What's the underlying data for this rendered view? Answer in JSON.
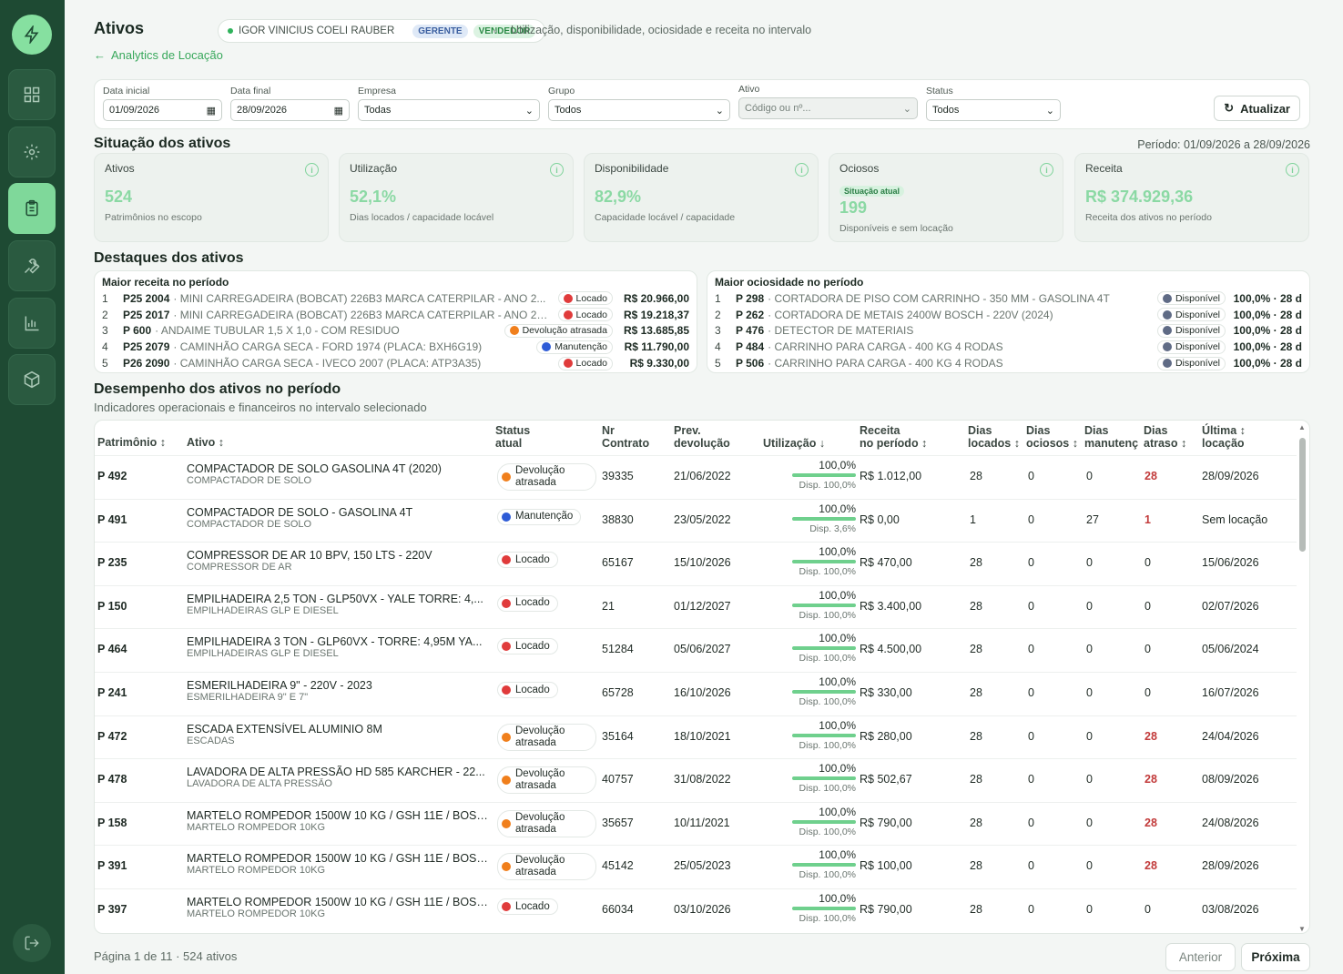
{
  "header": {
    "title": "Ativos",
    "user_name": "IGOR VINICIUS COELI RAUBER",
    "roles": [
      "GERENTE",
      "VENDEDOR"
    ],
    "subtitle": "Utilização, disponibilidade, ociosidade e receita no intervalo",
    "back_link": "Analytics de Locação"
  },
  "filters": {
    "data_inicial": {
      "label": "Data inicial",
      "value": "01/09/2026"
    },
    "data_final": {
      "label": "Data final",
      "value": "28/09/2026"
    },
    "empresa": {
      "label": "Empresa",
      "value": "Todas"
    },
    "grupo": {
      "label": "Grupo",
      "value": "Todos"
    },
    "ativo": {
      "label": "Ativo",
      "placeholder": "Código ou nº..."
    },
    "status": {
      "label": "Status",
      "value": "Todos"
    },
    "refresh_label": "Atualizar"
  },
  "situacao": {
    "title": "Situação dos ativos",
    "periodo": "Período: 01/09/2026 a 28/09/2026",
    "cards": [
      {
        "label": "Ativos",
        "value": "524",
        "desc": "Patrimônios no escopo"
      },
      {
        "label": "Utilização",
        "value": "52,1%",
        "desc": "Dias locados / capacidade locável"
      },
      {
        "label": "Disponibilidade",
        "value": "82,9%",
        "desc": "Capacidade locável / capacidade"
      },
      {
        "label": "Ociosos",
        "tag": "Situação atual",
        "value": "199",
        "desc": "Disponíveis e sem locação"
      },
      {
        "label": "Receita",
        "value": "R$ 374.929,36",
        "desc": "Receita dos ativos no período"
      }
    ]
  },
  "destaques": {
    "title": "Destaques dos ativos",
    "receita": {
      "title": "Maior receita no período",
      "rows": [
        {
          "n": "1",
          "pat": "P25 2004",
          "name": "· MINI CARREGADEIRA (BOBCAT) 226B3 MARCA CATERPILAR - ANO 2...",
          "status": "Locado",
          "value": "R$ 20.966,00"
        },
        {
          "n": "2",
          "pat": "P25 2017",
          "name": "· MINI CARREGADEIRA (BOBCAT) 226B3 MARCA CATERPILAR - ANO 2024",
          "status": "Locado",
          "value": "R$ 19.218,37"
        },
        {
          "n": "3",
          "pat": "P 600",
          "name": "· ANDAIME TUBULAR 1,5 X 1,0 - COM RESIDUO",
          "status": "Devolução atrasada",
          "value": "R$ 13.685,85"
        },
        {
          "n": "4",
          "pat": "P25 2079",
          "name": "· CAMINHÃO CARGA SECA - FORD 1974 (PLACA: BXH6G19)",
          "status": "Manutenção",
          "value": "R$ 11.790,00"
        },
        {
          "n": "5",
          "pat": "P26 2090",
          "name": "· CAMINHÃO CARGA SECA - IVECO 2007 (PLACA: ATP3A35)",
          "status": "Locado",
          "value": "R$ 9.330,00"
        }
      ]
    },
    "ociosidade": {
      "title": "Maior ociosidade no período",
      "rows": [
        {
          "n": "1",
          "pat": "P 298",
          "name": "· CORTADORA DE PISO COM CARRINHO - 350 MM - GASOLINA 4T",
          "status": "Disponível",
          "value": "100,0% · 28 d"
        },
        {
          "n": "2",
          "pat": "P 262",
          "name": "· CORTADORA DE METAIS 2400W BOSCH - 220V (2024)",
          "status": "Disponível",
          "value": "100,0% · 28 d"
        },
        {
          "n": "3",
          "pat": "P 476",
          "name": "· DETECTOR DE MATERIAIS",
          "status": "Disponível",
          "value": "100,0% · 28 d"
        },
        {
          "n": "4",
          "pat": "P 484",
          "name": "· CARRINHO PARA CARGA - 400 KG 4 RODAS",
          "status": "Disponível",
          "value": "100,0% · 28 d"
        },
        {
          "n": "5",
          "pat": "P 506",
          "name": "· CARRINHO PARA CARGA - 400 KG 4 RODAS",
          "status": "Disponível",
          "value": "100,0% · 28 d"
        }
      ]
    }
  },
  "desempenho": {
    "title": "Desempenho dos ativos no período",
    "subtitle": "Indicadores operacionais e financeiros no intervalo selecionado",
    "columns": {
      "patrimonio": "Patrimônio ↕",
      "ativo": "Ativo ↕",
      "status1": "Status",
      "status2": "atual",
      "contrato1": "Nr",
      "contrato2": "Contrato",
      "prev1": "Prev.",
      "prev2": "devolução",
      "util": "Utilização ↓",
      "receita1": "Receita",
      "receita2": "no período ↕",
      "locados1": "Dias",
      "locados2": "locados ↕",
      "ociosos1": "Dias",
      "ociosos2": "ociosos ↕",
      "manut1": "Dias",
      "manut2": "manutenç",
      "atraso1": "Dias",
      "atraso2": "atraso ↕",
      "ultima1": "Última ↕",
      "ultima2": "locação"
    },
    "rows": [
      {
        "pat": "P 492",
        "ativo": "COMPACTADOR DE SOLO GASOLINA 4T (2020)",
        "grupo": "COMPACTADOR DE SOLO",
        "status": "Devolução atrasada",
        "contrato": "39335",
        "prev": "21/06/2022",
        "util": "100,0%",
        "util_pct": 100,
        "disp": "Disp. 100,0%",
        "receita": "R$ 1.012,00",
        "locados": "28",
        "ociosos": "0",
        "manut": "0",
        "atraso": "28",
        "ultima": "28/09/2026"
      },
      {
        "pat": "P 491",
        "ativo": "COMPACTADOR DE SOLO - GASOLINA 4T",
        "grupo": "COMPACTADOR DE SOLO",
        "status": "Manutenção",
        "contrato": "38830",
        "prev": "23/05/2022",
        "util": "100,0%",
        "util_pct": 100,
        "disp": "Disp. 3,6%",
        "receita": "R$ 0,00",
        "locados": "1",
        "ociosos": "0",
        "manut": "27",
        "atraso": "1",
        "ultima": "Sem locação"
      },
      {
        "pat": "P 235",
        "ativo": "COMPRESSOR DE AR 10 BPV, 150 LTS - 220V",
        "grupo": "COMPRESSOR DE AR",
        "status": "Locado",
        "contrato": "65167",
        "prev": "15/10/2026",
        "util": "100,0%",
        "util_pct": 100,
        "disp": "Disp. 100,0%",
        "receita": "R$ 470,00",
        "locados": "28",
        "ociosos": "0",
        "manut": "0",
        "atraso": "0",
        "ultima": "15/06/2026"
      },
      {
        "pat": "P 150",
        "ativo": "EMPILHADEIRA 2,5 TON - GLP50VX - YALE TORRE: 4,...",
        "grupo": "EMPILHADEIRAS GLP E DIESEL",
        "status": "Locado",
        "contrato": "21",
        "prev": "01/12/2027",
        "util": "100,0%",
        "util_pct": 100,
        "disp": "Disp. 100,0%",
        "receita": "R$ 3.400,00",
        "locados": "28",
        "ociosos": "0",
        "manut": "0",
        "atraso": "0",
        "ultima": "02/07/2026"
      },
      {
        "pat": "P 464",
        "ativo": "EMPILHADEIRA 3 TON - GLP60VX - TORRE: 4,95M YA...",
        "grupo": "EMPILHADEIRAS GLP E DIESEL",
        "status": "Locado",
        "contrato": "51284",
        "prev": "05/06/2027",
        "util": "100,0%",
        "util_pct": 100,
        "disp": "Disp. 100,0%",
        "receita": "R$ 4.500,00",
        "locados": "28",
        "ociosos": "0",
        "manut": "0",
        "atraso": "0",
        "ultima": "05/06/2024"
      },
      {
        "pat": "P 241",
        "ativo": "ESMERILHADEIRA 9\" - 220V - 2023",
        "grupo": "ESMERILHADEIRA 9\" E 7\"",
        "status": "Locado",
        "contrato": "65728",
        "prev": "16/10/2026",
        "util": "100,0%",
        "util_pct": 100,
        "disp": "Disp. 100,0%",
        "receita": "R$ 330,00",
        "locados": "28",
        "ociosos": "0",
        "manut": "0",
        "atraso": "0",
        "ultima": "16/07/2026"
      },
      {
        "pat": "P 472",
        "ativo": "ESCADA EXTENSÍVEL ALUMINIO 8M",
        "grupo": "ESCADAS",
        "status": "Devolução atrasada",
        "contrato": "35164",
        "prev": "18/10/2021",
        "util": "100,0%",
        "util_pct": 100,
        "disp": "Disp. 100,0%",
        "receita": "R$ 280,00",
        "locados": "28",
        "ociosos": "0",
        "manut": "0",
        "atraso": "28",
        "ultima": "24/04/2026"
      },
      {
        "pat": "P 478",
        "ativo": "LAVADORA DE ALTA PRESSÃO HD 585 KARCHER - 22...",
        "grupo": "LAVADORA DE ALTA PRESSÃO",
        "status": "Devolução atrasada",
        "contrato": "40757",
        "prev": "31/08/2022",
        "util": "100,0%",
        "util_pct": 100,
        "disp": "Disp. 100,0%",
        "receita": "R$ 502,67",
        "locados": "28",
        "ociosos": "0",
        "manut": "0",
        "atraso": "28",
        "ultima": "08/09/2026"
      },
      {
        "pat": "P 158",
        "ativo": "MARTELO ROMPEDOR 1500W 10 KG / GSH 11E / BOSC...",
        "grupo": "MARTELO ROMPEDOR 10KG",
        "status": "Devolução atrasada",
        "contrato": "35657",
        "prev": "10/11/2021",
        "util": "100,0%",
        "util_pct": 100,
        "disp": "Disp. 100,0%",
        "receita": "R$ 790,00",
        "locados": "28",
        "ociosos": "0",
        "manut": "0",
        "atraso": "28",
        "ultima": "24/08/2026"
      },
      {
        "pat": "P 391",
        "ativo": "MARTELO ROMPEDOR 1500W 10 KG / GSH 11E / BOSC...",
        "grupo": "MARTELO ROMPEDOR 10KG",
        "status": "Devolução atrasada",
        "contrato": "45142",
        "prev": "25/05/2023",
        "util": "100,0%",
        "util_pct": 100,
        "disp": "Disp. 100,0%",
        "receita": "R$ 100,00",
        "locados": "28",
        "ociosos": "0",
        "manut": "0",
        "atraso": "28",
        "ultima": "28/09/2026"
      },
      {
        "pat": "P 397",
        "ativo": "MARTELO ROMPEDOR 1500W 10 KG / GSH 11E / BOSC...",
        "grupo": "MARTELO ROMPEDOR 10KG",
        "status": "Locado",
        "contrato": "66034",
        "prev": "03/10/2026",
        "util": "100,0%",
        "util_pct": 100,
        "disp": "Disp. 100,0%",
        "receita": "R$ 790,00",
        "locados": "28",
        "ociosos": "0",
        "manut": "0",
        "atraso": "0",
        "ultima": "03/08/2026"
      }
    ]
  },
  "pagination": {
    "info": "Página 1 de 11 · 524 ativos",
    "prev": "Anterior",
    "next": "Próxima"
  },
  "status_colors": {
    "Locado": "#e03b3b",
    "Devolução atrasada": "#f07f1c",
    "Manutenção": "#2d5bd6",
    "Disponível": "#5f6b85"
  },
  "sidebar_icons": [
    "bolt-icon",
    "dashboard-grid-icon",
    "settings-gear-icon",
    "clipboard-icon",
    "wrench-icon",
    "bar-chart-icon",
    "box-icon",
    "logout-icon"
  ]
}
